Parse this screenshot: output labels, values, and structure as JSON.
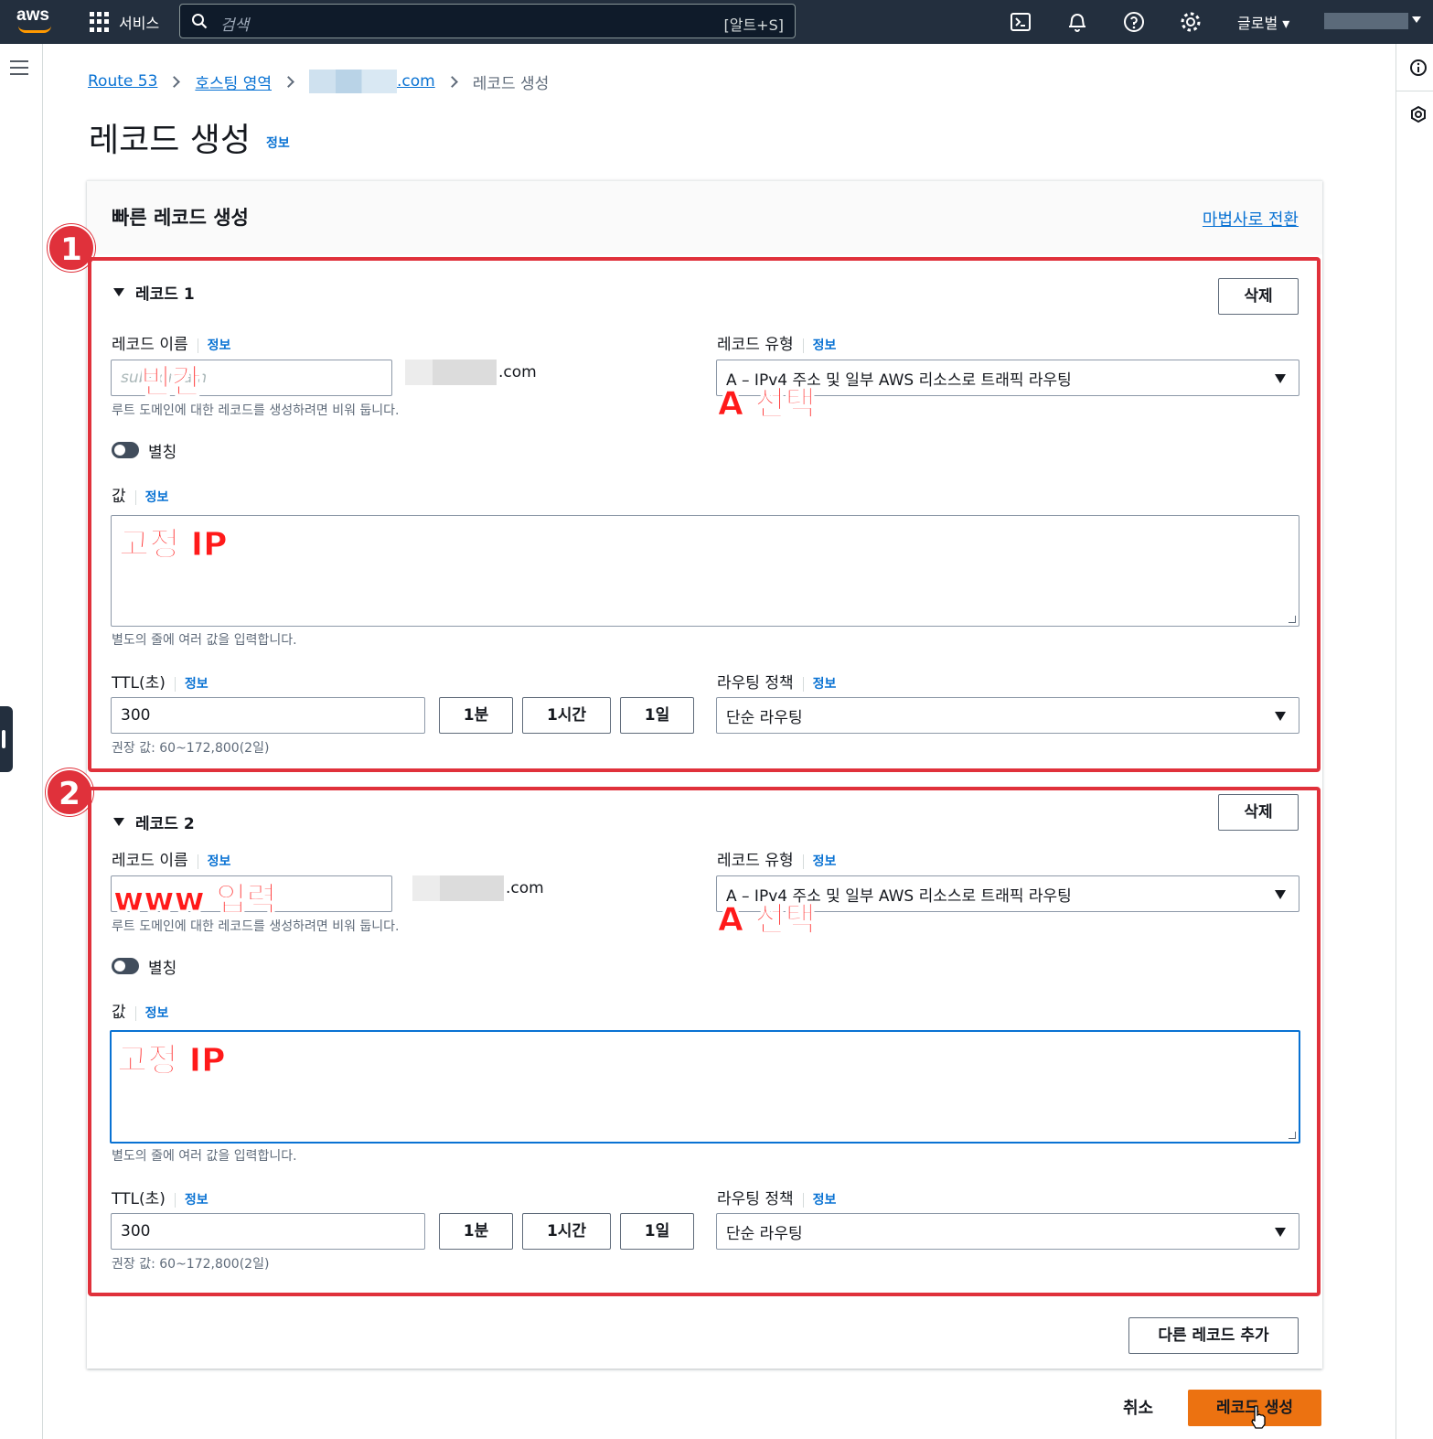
{
  "nav": {
    "services": "서비스",
    "search_placeholder": "검색",
    "search_hotkey": "[알트+S]",
    "region": "글로벌"
  },
  "breadcrumb": {
    "root": "Route 53",
    "hosted_zones": "호스팅 영역",
    "domain_suffix": ".com",
    "current": "레코드 생성"
  },
  "page": {
    "title": "레코드 생성",
    "info": "정보"
  },
  "container": {
    "title": "빠른 레코드 생성",
    "wizard_link": "마법사로 전환"
  },
  "labels": {
    "delete": "삭제",
    "record_name": "레코드 이름",
    "record_type": "레코드 유형",
    "info": "정보",
    "name_hint": "루트 도메인에 대한 레코드를 생성하려면 비워 둡니다.",
    "alias": "별칭",
    "value": "값",
    "value_hint": "별도의 줄에 여러 값을 입력합니다.",
    "ttl": "TTL(초)",
    "ttl_1m": "1분",
    "ttl_1h": "1시간",
    "ttl_1d": "1일",
    "ttl_hint": "권장 값: 60~172,800(2일)",
    "routing_policy": "라우팅 정책",
    "domain_suffix": ".com"
  },
  "records": [
    {
      "number": "1",
      "heading": "레코드 1",
      "name_placeholder": "subdomain",
      "type": "A – IPv4 주소 및 일부 AWS 리소스로 트래픽 라우팅",
      "ttl": "300",
      "routing": "단순 라우팅",
      "annot_name": "빈칸",
      "annot_type": "A 선택",
      "annot_value": "고정 IP"
    },
    {
      "number": "2",
      "heading": "레코드 2",
      "name_placeholder": "",
      "type": "A – IPv4 주소 및 일부 AWS 리소스로 트래픽 라우팅",
      "ttl": "300",
      "routing": "단순 라우팅",
      "annot_name": "www 입력",
      "annot_type": "A 선택",
      "annot_value": "고정 IP"
    }
  ],
  "footer": {
    "add_record": "다른 레코드 추가",
    "cancel": "취소",
    "create": "레코드 생성"
  },
  "colors": {
    "nav_bg": "#232f3e",
    "link": "#0972d3",
    "primary_button": "#ec7211",
    "annotation": "#e0313b"
  }
}
